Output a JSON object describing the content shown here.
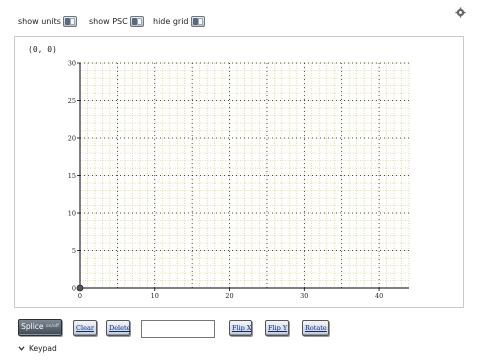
{
  "toggles": [
    {
      "label": "show units"
    },
    {
      "label": "show PSC"
    },
    {
      "label": "hide grid"
    }
  ],
  "icons": {
    "settings": "gear-icon",
    "keypad_chevron": "chevron-down-icon"
  },
  "coordinate_readout": "(0, 0)",
  "chart_data": {
    "type": "scatter",
    "title": "",
    "xlabel": "",
    "ylabel": "",
    "xlim": [
      0,
      44
    ],
    "ylim": [
      0,
      30
    ],
    "x_ticks": [
      0,
      10,
      20,
      30,
      40
    ],
    "y_ticks": [
      0,
      5,
      10,
      15,
      20,
      25,
      30
    ],
    "grid": true,
    "series": [
      {
        "x": [
          0
        ],
        "y": [
          0
        ]
      }
    ]
  },
  "buttons": {
    "splice": "Splice",
    "splice_sub": "on/off",
    "clear": "Clear",
    "delete": "Delete",
    "flip_x": "Flip X",
    "flip_y": "Flip Y",
    "rotate": "Rotate"
  },
  "input": {
    "value": ""
  },
  "keypad": {
    "label": "Keypad"
  },
  "colors": {
    "grid_minor": "#c9c46a",
    "grid_major": "#1a1a1a",
    "axis": "#000000",
    "button_text": "#0a2a80"
  }
}
